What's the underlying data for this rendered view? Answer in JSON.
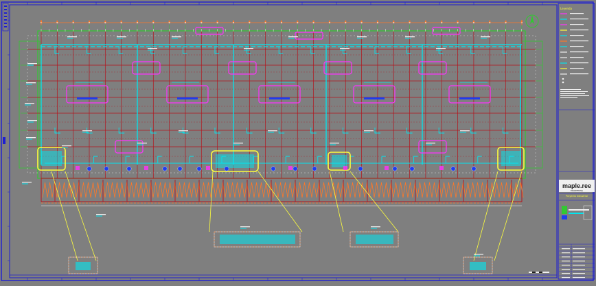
{
  "colors": {
    "background": "#7f7f7f",
    "frame": "#1e1ed2",
    "grid_red": "#b4141e",
    "grid_green": "#32c832",
    "cyan": "#00e6f0",
    "magenta": "#ff32ff",
    "yellow": "#ffff3c",
    "orange": "#ff7828",
    "white": "#f0f0f0",
    "blue_equipment": "#1e3cf0"
  },
  "title_block": {
    "logo_name": "maple.ree",
    "logo_sub": "ENGINEERING",
    "project_caption": "Proyecto Industrial"
  },
  "legend_title": "Leyenda",
  "icons": [
    "north-arrow-icon",
    "logo-icon",
    "pump-icon",
    "valve-icon"
  ]
}
